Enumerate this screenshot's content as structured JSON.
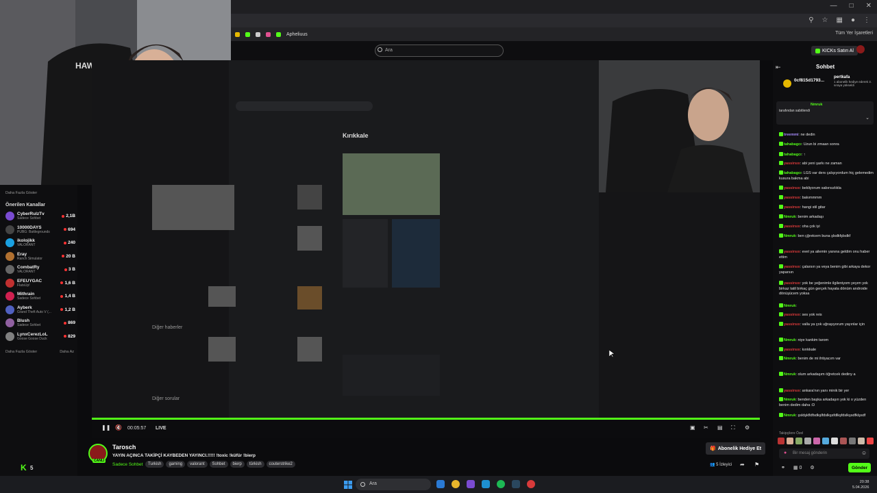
{
  "browser": {
    "bookmarks": [
      "Apheliuus"
    ],
    "bookmarks_right": "Tüm Yer İşaretleri"
  },
  "kick": {
    "search_placeholder": "Ara",
    "buy_kicks": "KICKs Satın Al",
    "brand_color": "#53fc18"
  },
  "sidebar": {
    "more_top": "Daha Fazla Göster",
    "heading": "Önerilen Kanallar",
    "channels": [
      {
        "name": "CyberRulzTv",
        "category": "Sadece Sohbet",
        "viewers": "2,1B",
        "color": "#7a4bd1"
      },
      {
        "name": "10000DAYS",
        "category": "PUBG: Battlegrounds",
        "viewers": "694",
        "color": "#444"
      },
      {
        "name": "ikolojikk",
        "category": "VALORANT",
        "viewers": "240",
        "color": "#1aa0e0"
      },
      {
        "name": "Eray",
        "category": "Ranch Simulator",
        "viewers": "20 B",
        "color": "#b07030"
      },
      {
        "name": "CombatRy",
        "category": "VALORANT",
        "viewers": "3 B",
        "color": "#666"
      },
      {
        "name": "EFEUYGAC",
        "category": "FlatsUp!",
        "viewers": "1,6 B",
        "color": "#c03030"
      },
      {
        "name": "Mithrain",
        "category": "Sadece Sohbet",
        "viewers": "1,4 B",
        "color": "#d02050"
      },
      {
        "name": "Ayberk",
        "category": "Grand Theft Auto V (...",
        "viewers": "1,2 B",
        "color": "#5060c0"
      },
      {
        "name": "Blush",
        "category": "Sadece Sohbet",
        "viewers": "869",
        "color": "#9060a0"
      },
      {
        "name": "LynxCerezLoL",
        "category": "Goose Goose Duck",
        "viewers": "829",
        "color": "#808080"
      }
    ],
    "more_bottom": "Daha Fazla Göster",
    "less": "Daha Az",
    "footer_count": "5"
  },
  "player": {
    "time": "00:05:57",
    "live": "LIVE"
  },
  "stream": {
    "streamer": "Tarosch",
    "live_badge": "CANLI",
    "title": "YAYIN AÇINCA TAKİPÇİ KAYBEDEN YAYINCI.!!!!! !toxic !küfür !bierp",
    "category": "Sadece Sohbet",
    "tags": [
      "Turkish",
      "gaming",
      "valorant",
      "Sohbet",
      "bierp",
      "türkish",
      "couterstrike2"
    ],
    "gift_button": "Abonelik Hediye Et",
    "viewers": "5 İzleyici"
  },
  "chat": {
    "title": "Sohbet",
    "sub_card": {
      "user": "0cf815d1793...",
      "gifter": "pertkafa",
      "text": "1 abonelik hediye ederek 3. sıraya yükseldi"
    },
    "pinned": {
      "user": "Nmruk",
      "text": "tarafından sabitlendi"
    },
    "messages": [
      {
        "user": "treemmi",
        "text": ": ne dedin",
        "color": "#a78bfa"
      },
      {
        "user": "tahabagcı",
        "text": ": Uzun bi zmaan sonra",
        "color": "#53fc18"
      },
      {
        "user": "tahabagcı",
        "text": ": ↑",
        "color": "#53fc18"
      },
      {
        "user": "yassirsıx",
        "text": ": abi yeni şarkı ne zaman",
        "color": "#e03c3c"
      },
      {
        "user": "tahabagcı",
        "text": ": LGS var ders çalışıyordum hiç gelemedim kusura bakma abi",
        "color": "#53fc18"
      },
      {
        "user": "yassirsıx",
        "text": ": bekliyorum sabırsızlıkla",
        "color": "#e03c3c"
      },
      {
        "user": "yassirsıx",
        "text": ": bakımmmm",
        "color": "#e03c3c"
      },
      {
        "user": "yassirsıx",
        "text": ": hangi stil gitar",
        "color": "#e03c3c"
      },
      {
        "user": "Nmruk",
        "text": ": benim arkadaşı",
        "color": "#53fc18"
      },
      {
        "user": "yassirsıx",
        "text": ": oha çok iyi",
        "color": "#e03c3c"
      },
      {
        "user": "Nmruk",
        "text": ": ben çğretcem buna şlsdkfşlsdkf",
        "color": "#53fc18"
      },
      {
        "user": "yassirsıx",
        "text": ": evet ya ailemin yanına geldim onu haber ettim",
        "color": "#e03c3c"
      },
      {
        "user": "yassirsıx",
        "text": ": çalarsın ya veya benim gibi arkaya dekor yaparsın",
        "color": "#e03c3c"
      },
      {
        "user": "yassirsıx",
        "text": ": yok be yeğenimle ilgileniyom yeyım yok birkaz tatil birkaç gün gerçek hayata dönüm androide dönüşücem yoksa",
        "color": "#e03c3c"
      },
      {
        "user": "Nmruk",
        "text": ":",
        "color": "#53fc18"
      },
      {
        "user": "yassirsıx",
        "text": ": ses yok reis",
        "color": "#e03c3c"
      },
      {
        "user": "yassirsıx",
        "text": ": valla ya çok uğraşıyorum yayınlar için",
        "color": "#e03c3c"
      },
      {
        "user": "Nmruk",
        "text": ": niye kankim tarom",
        "color": "#53fc18"
      },
      {
        "user": "yassirsıx",
        "text": ": kırıkkale",
        "color": "#e03c3c"
      },
      {
        "user": "Nmruk",
        "text": ": benim de mi ihtiyacım var",
        "color": "#53fc18"
      },
      {
        "user": "Nmruk",
        "text": ": olum arkadaşım öğretcek dediny a",
        "color": "#53fc18"
      },
      {
        "user": "yassirsıx",
        "text": ": ankara'nın yanı minik bir yer",
        "color": "#e03c3c"
      },
      {
        "user": "Nmruk",
        "text": ": benden başka arkadaşın yok ki o yüzden benim dedim daha :D",
        "color": "#53fc18"
      },
      {
        "user": "Nmruk",
        "text": ": şsldşkfldfsdkşlfdslkşsfdlkşfdslkşsdfklşsdf",
        "color": "#53fc18"
      }
    ],
    "emote_label": "Takipçilere Özel",
    "input_placeholder": "Bir mesaj gönderin",
    "send": "Gönder",
    "footer_points": "0"
  },
  "taskbar": {
    "search": "Ara",
    "time": "20:38",
    "date": "5.04.2026"
  },
  "page_ui": {
    "map_title": "Kırıkkale",
    "more_news": "Diğer haberler",
    "other_questions": "Diğer sorular"
  }
}
